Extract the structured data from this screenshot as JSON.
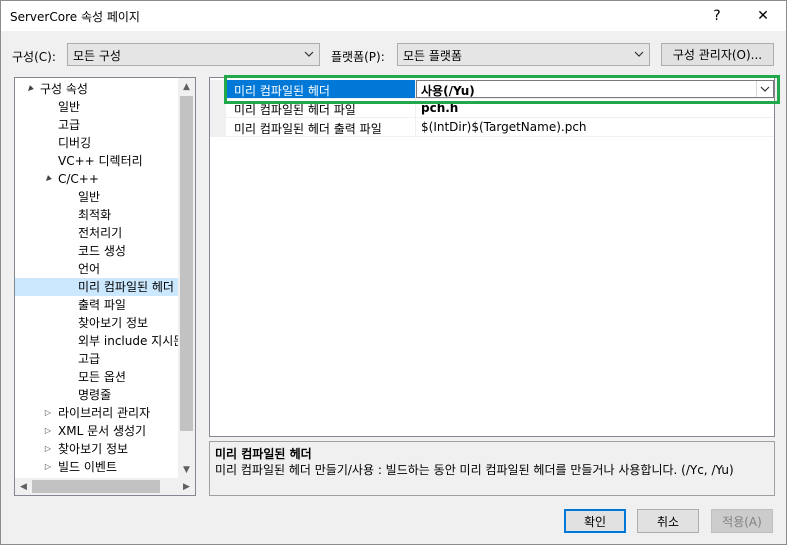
{
  "window": {
    "title": "ServerCore 속성 페이지",
    "help": "?",
    "close": "✕"
  },
  "config": {
    "label": "구성(C):",
    "value": "모든 구성"
  },
  "platform": {
    "label": "플랫폼(P):",
    "value": "모든 플랫폼"
  },
  "config_manager": "구성 관리자(O)...",
  "tree": [
    {
      "label": "구성 속성",
      "level": 0,
      "toggle": "▲"
    },
    {
      "label": "일반",
      "level": 1,
      "toggle": ""
    },
    {
      "label": "고급",
      "level": 1,
      "toggle": ""
    },
    {
      "label": "디버깅",
      "level": 1,
      "toggle": ""
    },
    {
      "label": "VC++ 디렉터리",
      "level": 1,
      "toggle": ""
    },
    {
      "label": "C/C++",
      "level": 1,
      "toggle": "▲"
    },
    {
      "label": "일반",
      "level": 2,
      "toggle": ""
    },
    {
      "label": "최적화",
      "level": 2,
      "toggle": ""
    },
    {
      "label": "전처리기",
      "level": 2,
      "toggle": ""
    },
    {
      "label": "코드 생성",
      "level": 2,
      "toggle": ""
    },
    {
      "label": "언어",
      "level": 2,
      "toggle": ""
    },
    {
      "label": "미리 컴파일된 헤더",
      "level": 2,
      "toggle": "",
      "selected": true
    },
    {
      "label": "출력 파일",
      "level": 2,
      "toggle": ""
    },
    {
      "label": "찾아보기 정보",
      "level": 2,
      "toggle": ""
    },
    {
      "label": "외부 include 지시문",
      "level": 2,
      "toggle": ""
    },
    {
      "label": "고급",
      "level": 2,
      "toggle": ""
    },
    {
      "label": "모든 옵션",
      "level": 2,
      "toggle": ""
    },
    {
      "label": "명령줄",
      "level": 2,
      "toggle": ""
    },
    {
      "label": "라이브러리 관리자",
      "level": 1,
      "toggle": "▷"
    },
    {
      "label": "XML 문서 생성기",
      "level": 1,
      "toggle": "▷"
    },
    {
      "label": "찾아보기 정보",
      "level": 1,
      "toggle": "▷"
    },
    {
      "label": "빌드 이벤트",
      "level": 1,
      "toggle": "▷"
    }
  ],
  "properties": [
    {
      "name": "미리 컴파일된 헤더",
      "value": "사용(/Yu)",
      "selected": true
    },
    {
      "name": "미리 컴파일된 헤더 파일",
      "value": "pch.h",
      "bold": true
    },
    {
      "name": "미리 컴파일된 헤더 출력 파일",
      "value": "$(IntDir)$(TargetName).pch"
    }
  ],
  "description": {
    "title": "미리 컴파일된 헤더",
    "text": "미리 컴파일된 헤더 만들기/사용 : 빌드하는 동안 미리 컴파일된 헤더를 만들거나 사용합니다.     (/Yc, /Yu)"
  },
  "buttons": {
    "ok": "확인",
    "cancel": "취소",
    "apply": "적용(A)"
  },
  "colors": {
    "selection": "#0078d7",
    "tree_selection": "#cce8ff",
    "highlight": "#21a84a"
  }
}
